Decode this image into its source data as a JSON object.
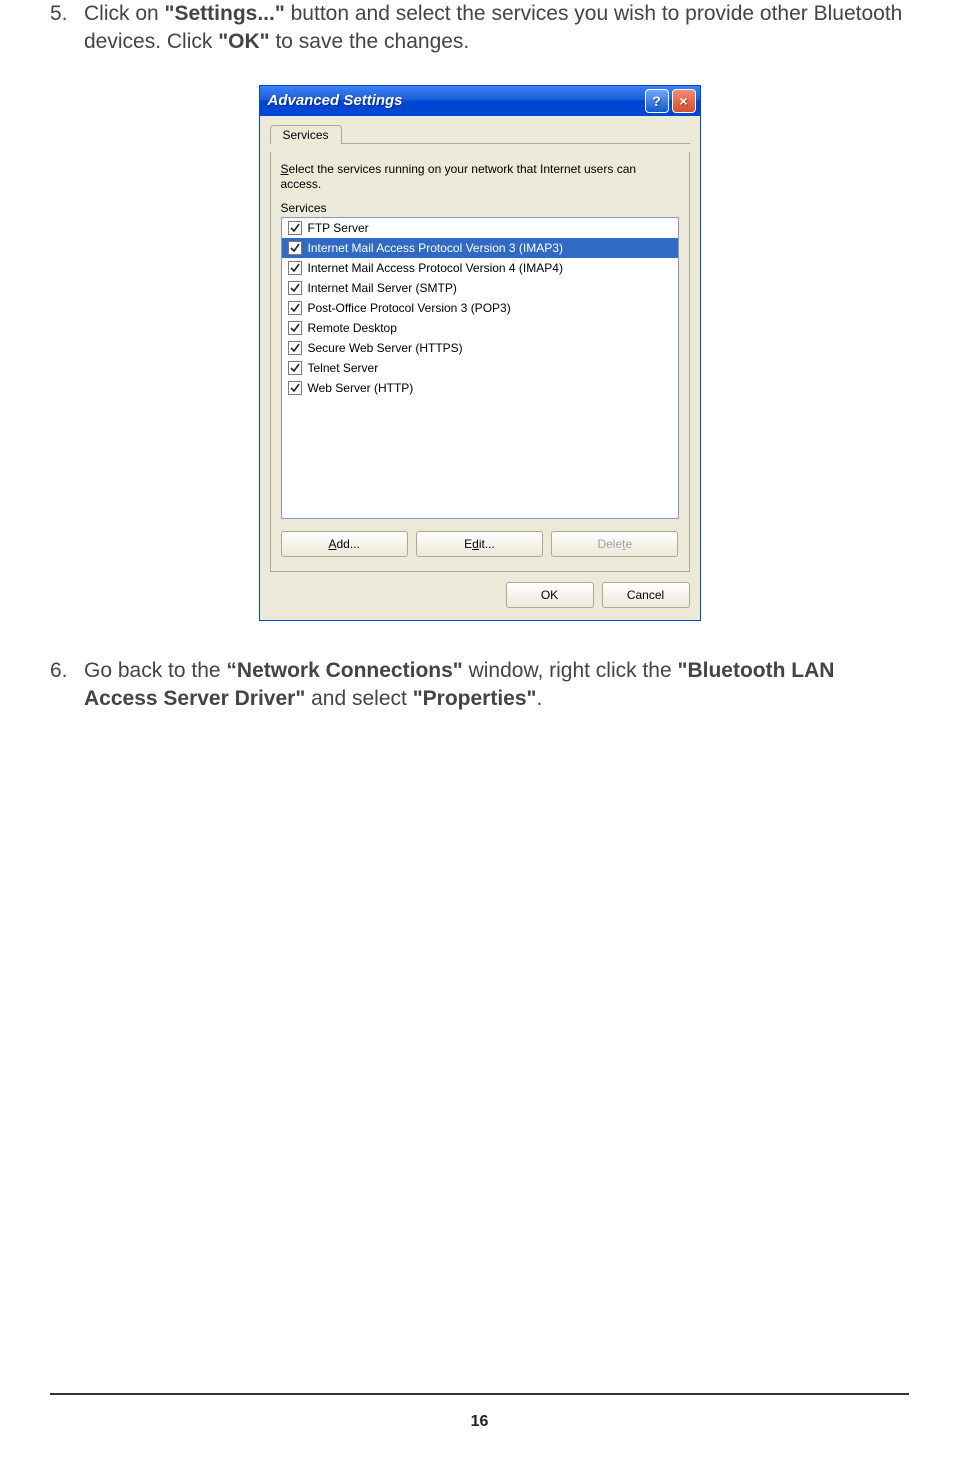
{
  "step5": {
    "num": "5.",
    "t1": "Click on ",
    "b1": "\"Settings...\"",
    "t2": " button and select the services you wish to provide other Bluetooth devices. Click ",
    "b2": "\"OK\"",
    "t3": " to save the changes."
  },
  "step6": {
    "num": "6.",
    "t1": "Go back to the ",
    "b1": "“Network Connections\"",
    "t2": " window, right click the ",
    "b2": "\"Bluetooth LAN Access Server Driver\"",
    "t3": " and select ",
    "b3": "\"Properties\"",
    "t4": "."
  },
  "dialog": {
    "title": "Advanced Settings",
    "help": "?",
    "close": "×",
    "tab": "Services",
    "desc_pre": "S",
    "desc_rest": "elect the services running on your network that Internet users can access.",
    "list_label_pre": "Services",
    "items": [
      {
        "label": "FTP Server",
        "checked": true,
        "selected": false
      },
      {
        "label": "Internet Mail Access Protocol Version 3 (IMAP3)",
        "checked": true,
        "selected": true
      },
      {
        "label": "Internet Mail Access Protocol Version 4 (IMAP4)",
        "checked": true,
        "selected": false
      },
      {
        "label": "Internet Mail Server (SMTP)",
        "checked": true,
        "selected": false
      },
      {
        "label": "Post-Office Protocol Version 3 (POP3)",
        "checked": true,
        "selected": false
      },
      {
        "label": "Remote Desktop",
        "checked": true,
        "selected": false
      },
      {
        "label": "Secure Web Server (HTTPS)",
        "checked": true,
        "selected": false
      },
      {
        "label": "Telnet Server",
        "checked": true,
        "selected": false
      },
      {
        "label": "Web Server (HTTP)",
        "checked": true,
        "selected": false
      }
    ],
    "btn_add_u": "A",
    "btn_add_rest": "dd...",
    "btn_edit_pre": "E",
    "btn_edit_u": "d",
    "btn_edit_rest": "it...",
    "btn_delete_pre": "Dele",
    "btn_delete_u": "t",
    "btn_delete_rest": "e",
    "btn_ok": "OK",
    "btn_cancel": "Cancel"
  },
  "page_number": "16"
}
